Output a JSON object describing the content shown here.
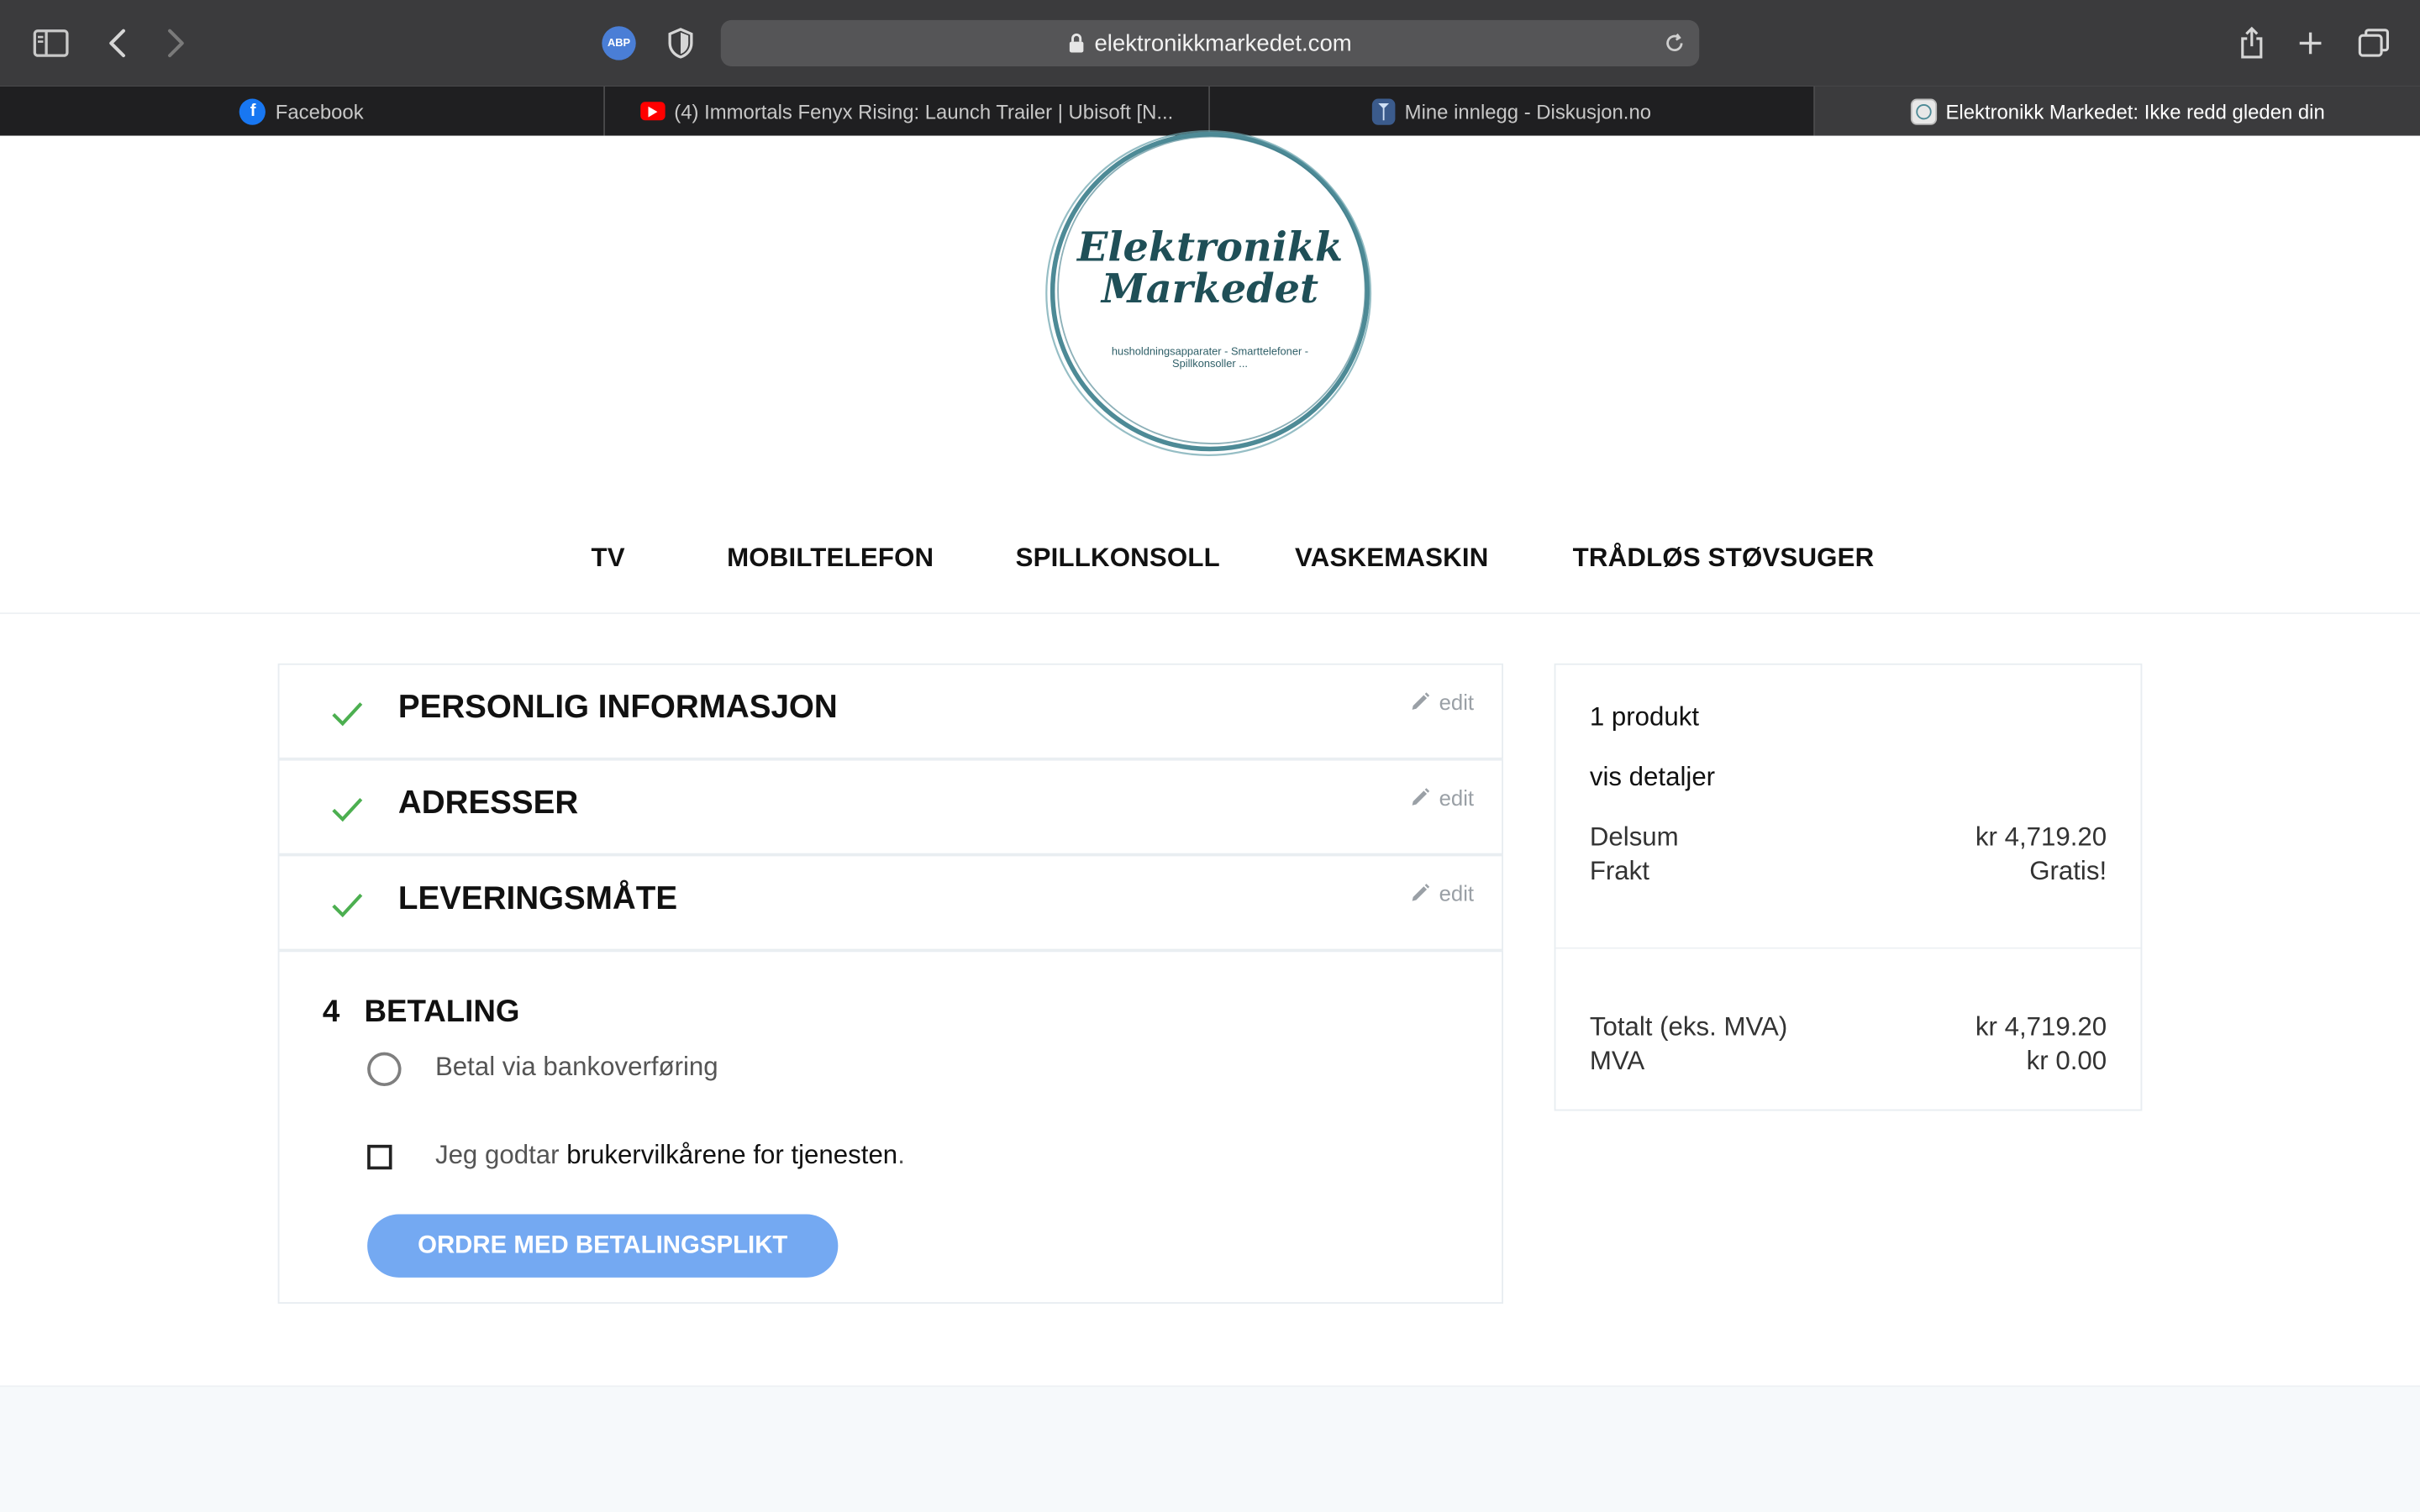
{
  "browser": {
    "url": "elektronikkmarkedet.com",
    "abp_label": "ABP",
    "tabs": [
      {
        "label": "Facebook",
        "favicon": "facebook-icon",
        "color": "#1877f2"
      },
      {
        "label": "(4) Immortals Fenyx Rising: Launch Trailer | Ubisoft [N...",
        "favicon": "youtube-icon",
        "color": "#ff0000"
      },
      {
        "label": "Mine innlegg - Diskusjon.no",
        "favicon": "diskusjon-icon",
        "color": "#3b5b8c"
      },
      {
        "label": "Elektronikk Markedet: Ikke redd gleden din",
        "favicon": "site-icon",
        "color": "#dddddd"
      }
    ]
  },
  "logo": {
    "line1": "Elektronikk",
    "line2": "Markedet",
    "tagline1": "husholdningsapparater - Smarttelefoner -",
    "tagline2": "Spillkonsoller ..."
  },
  "nav": {
    "items": [
      "TV",
      "MOBILTELEFON",
      "SPILLKONSOLL",
      "VASKEMASKIN",
      "TRÅDLØS STØVSUGER"
    ]
  },
  "checkout": {
    "edit_label": "edit",
    "steps": [
      {
        "title": "PERSONLIG INFORMASJON"
      },
      {
        "title": "ADRESSER"
      },
      {
        "title": "LEVERINGSMÅTE"
      }
    ],
    "payment": {
      "number": "4",
      "title": "BETALING",
      "option": "Betal via bankoverføring",
      "terms_prefix": "Jeg godtar ",
      "terms_link": "brukervilkårene for tjenesten",
      "terms_suffix": ".",
      "button": "ORDRE MED BETALINGSPLIKT"
    }
  },
  "summary": {
    "count": "1 produkt",
    "details": "vis detaljer",
    "subtotal_label": "Delsum",
    "subtotal_value": "kr 4,719.20",
    "shipping_label": "Frakt",
    "shipping_value": "Gratis!",
    "total_label": "Totalt (eks. MVA)",
    "total_value": "kr 4,719.20",
    "vat_label": "MVA",
    "vat_value": "kr 0.00"
  },
  "colors": {
    "accent": "#74a9f2",
    "check": "#4caf50",
    "logo_ring": "#4d8a96"
  }
}
